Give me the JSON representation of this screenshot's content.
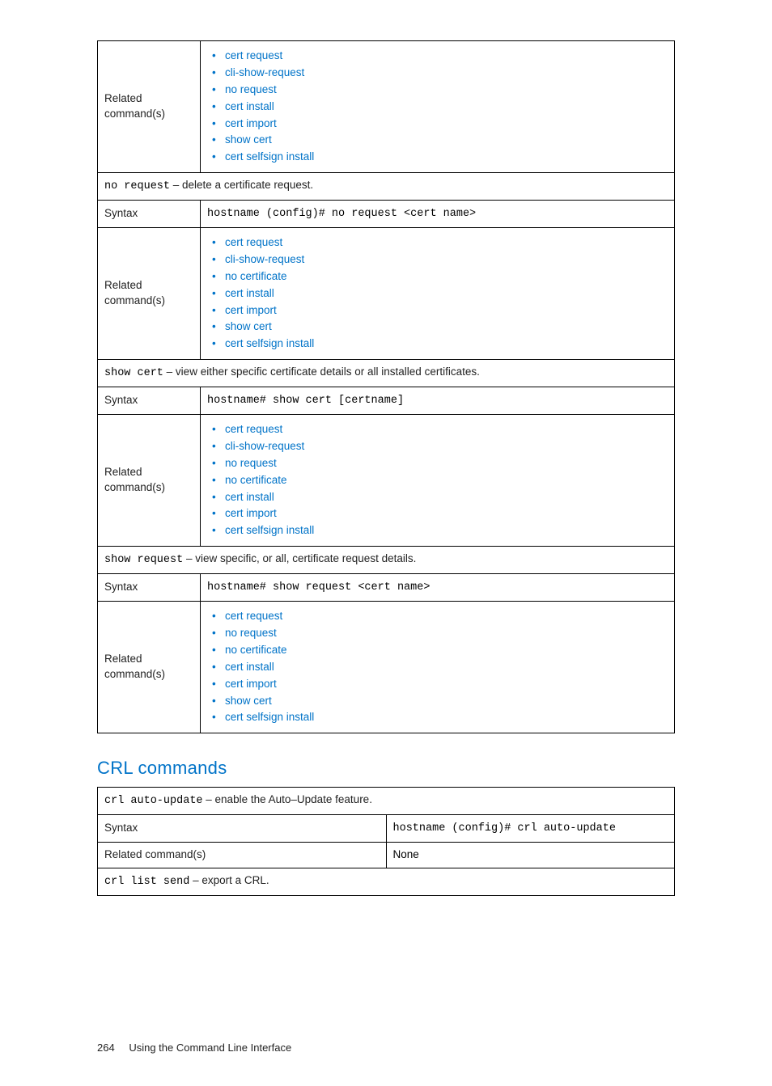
{
  "table1": {
    "rows": [
      {
        "type": "related",
        "label": "Related command(s)",
        "items": [
          "cert request",
          "cli-show-request",
          "no request",
          "cert install",
          "cert import",
          "show cert",
          "cert selfsign install"
        ]
      },
      {
        "type": "desc",
        "cmd": "no request",
        "text": " – delete a certificate request."
      },
      {
        "type": "syntax",
        "label": "Syntax",
        "code": "hostname (config)# no request <cert name>"
      },
      {
        "type": "related",
        "label": "Related command(s)",
        "items": [
          "cert request",
          "cli-show-request",
          "no certificate",
          "cert install",
          "cert import",
          "show cert",
          "cert selfsign install"
        ]
      },
      {
        "type": "desc",
        "cmd": "show cert",
        "text": " – view either specific certificate details or all installed certificates."
      },
      {
        "type": "syntax",
        "label": "Syntax",
        "code": "hostname# show cert [certname]"
      },
      {
        "type": "related",
        "label": "Related command(s)",
        "items": [
          "cert request",
          "cli-show-request",
          "no request",
          "no certificate",
          "cert install",
          "cert import",
          "cert selfsign install"
        ]
      },
      {
        "type": "desc",
        "cmd": "show request",
        "text": " – view specific, or all, certificate request details."
      },
      {
        "type": "syntax",
        "label": "Syntax",
        "code": "hostname# show request <cert name>"
      },
      {
        "type": "related",
        "label": "Related command(s)",
        "items": [
          "cert request",
          "no request",
          "no certificate",
          "cert install",
          "cert import",
          "show cert",
          "cert selfsign install"
        ]
      }
    ]
  },
  "section_heading": "CRL commands",
  "table2": {
    "rows": [
      {
        "type": "desc",
        "cmd": "crl auto-update",
        "text": " – enable the Auto–Update feature."
      },
      {
        "type": "syntax",
        "label": "Syntax",
        "code": "hostname (config)# crl auto-update"
      },
      {
        "type": "plain",
        "label": "Related command(s)",
        "value": "None"
      },
      {
        "type": "desc",
        "cmd": "crl list send",
        "text": " – export a CRL."
      }
    ]
  },
  "footer": {
    "page": "264",
    "title": "Using the Command Line Interface"
  }
}
